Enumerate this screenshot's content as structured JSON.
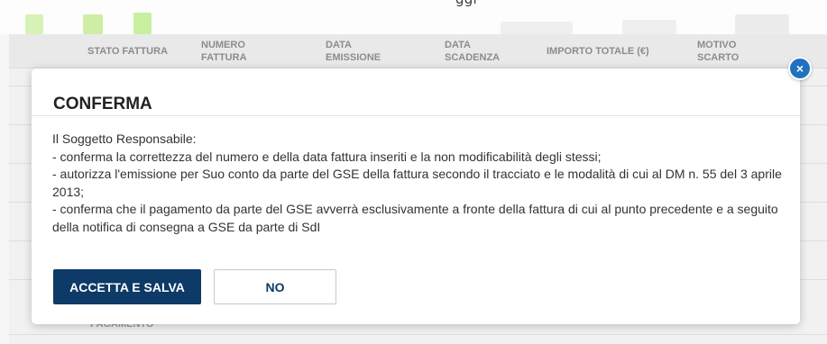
{
  "background": {
    "top_text": "ggi",
    "table_headers": [
      "STATO FATTURA",
      "NUMERO FATTURA",
      "DATA EMISSIONE",
      "DATA SCADENZA",
      "IMPORTO TOTALE (€)",
      "MOTIVO SCARTO"
    ],
    "visible_cell": "PAGAMENTO"
  },
  "modal": {
    "title": "CONFERMA",
    "close_icon": "×",
    "body": [
      "Il Soggetto Responsabile:",
      "- conferma la correttezza del numero e della data fattura inseriti e la non modificabilità degli stessi;",
      "- autorizza l'emissione per Suo conto da parte del GSE della fattura secondo il tracciato e le modalità di cui al DM n. 55 del 3 aprile 2013;",
      "- conferma che il pagamento da parte del GSE avverrà esclusivamente a fronte della fattura di cui al punto precedente e a seguito della notifica di consegna a GSE da parte di SdI"
    ],
    "accept_label": "ACCETTA E SALVA",
    "no_label": "NO"
  },
  "colors": {
    "primary": "#0d3a66",
    "close_button": "#1e73be",
    "top_blobs": "#c9efa0"
  }
}
